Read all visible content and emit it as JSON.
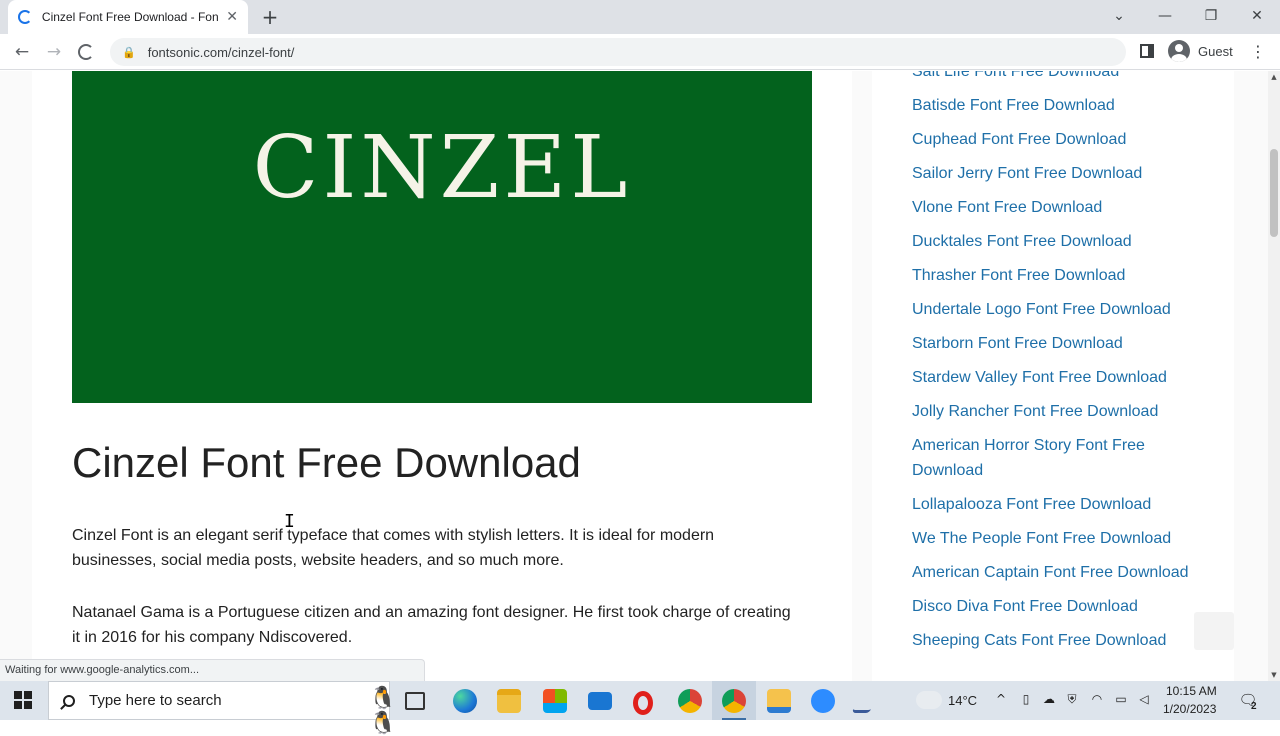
{
  "browser": {
    "tab_title": "Cinzel Font Free Download - Fon",
    "tab_close": "✕",
    "new_tab": "+",
    "window_controls": {
      "dropdown": "⌄",
      "minimize": "—",
      "restore": "❐",
      "close": "✕"
    },
    "nav": {
      "back": "←",
      "forward": "→"
    },
    "lock_icon": "🔒",
    "url": "fontsonic.com/cinzel-font/",
    "profile_label": "Guest",
    "menu": "⋮"
  },
  "page": {
    "hero_word": "CINZEL",
    "hero_bg": "#03621d",
    "title": "Cinzel Font Free Download",
    "paragraphs": [
      "Cinzel Font is an elegant serif typeface that comes with stylish letters. It is ideal for modern businesses, social media posts, website headers, and so much more.",
      "Natanael Gama is a Portuguese citizen and an amazing font designer. He first took charge of creating it in 2016 for his company Ndiscovered."
    ],
    "sidebar_links": [
      "Salt Life Font Free Download",
      "Batisde Font Free Download",
      "Cuphead Font Free Download",
      "Sailor Jerry Font Free Download",
      "Vlone Font Free Download",
      "Ducktales Font Free Download",
      "Thrasher Font Free Download",
      "Undertale Logo Font Free Download",
      "Starborn Font Free Download",
      "Stardew Valley Font Free Download",
      "Jolly Rancher Font Free Download",
      "American Horror Story Font Free Download",
      "Lollapalooza Font Free Download",
      "We The People Font Free Download",
      "American Captain Font Free Download",
      "Disco Diva Font Free Download",
      "Sheeping Cats Font Free Download"
    ],
    "link_color": "#1e6fa8"
  },
  "status_bar": "Waiting for www.google-analytics.com...",
  "taskbar": {
    "search_placeholder": "Type here to search",
    "temperature": "14°C",
    "time": "10:15 AM",
    "date": "1/20/2023",
    "notification_count": "2",
    "apps": [
      "task-view",
      "edge",
      "file-explorer",
      "microsoft-store",
      "mail",
      "opera",
      "chrome",
      "chrome-active",
      "files",
      "zoom",
      "pen-app"
    ]
  }
}
